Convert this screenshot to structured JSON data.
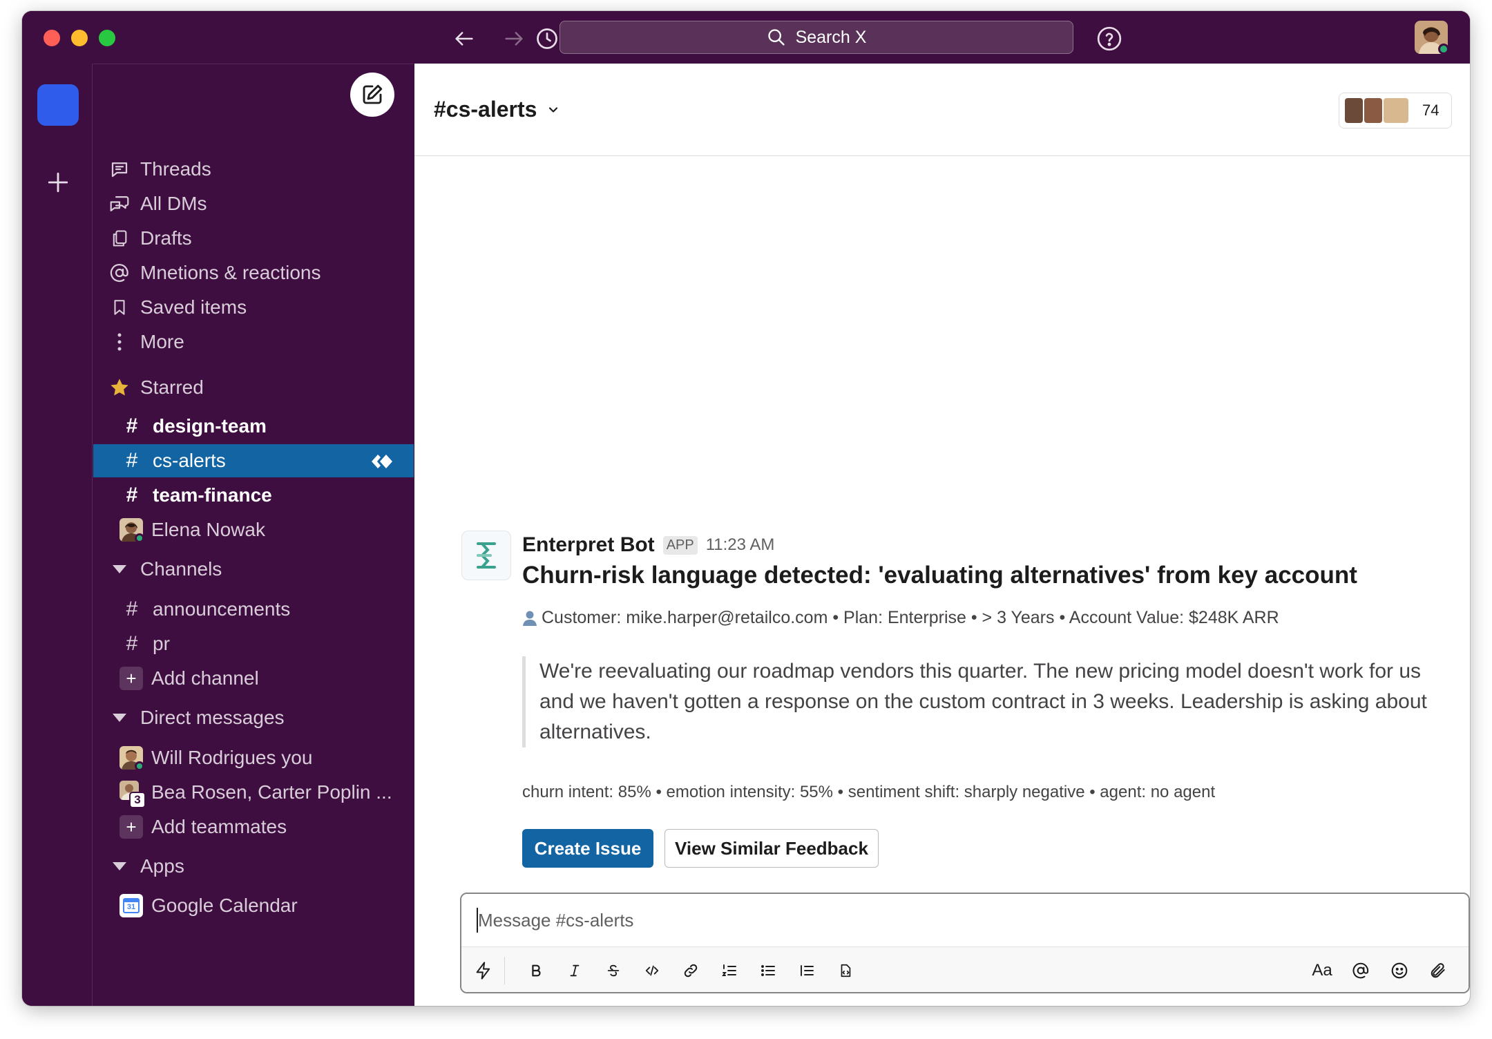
{
  "titlebar": {
    "search_text": "Search X"
  },
  "sidebar": {
    "nav": [
      {
        "label": "Threads",
        "icon": "threads-icon"
      },
      {
        "label": "All DMs",
        "icon": "dms-icon"
      },
      {
        "label": "Drafts",
        "icon": "drafts-icon"
      },
      {
        "label": "Mnetions & reactions",
        "icon": "at-icon"
      },
      {
        "label": "Saved items",
        "icon": "bookmark-icon"
      },
      {
        "label": "More",
        "icon": "more-vertical-icon"
      }
    ],
    "starred": {
      "label": "Starred",
      "items": [
        {
          "hash": "#",
          "label": "design-team"
        },
        {
          "hash": "#",
          "label": "cs-alerts"
        },
        {
          "hash": "#",
          "label": "team-finance"
        },
        {
          "label": "Elena Nowak"
        }
      ]
    },
    "channels": {
      "label": "Channels",
      "items": [
        {
          "hash": "#",
          "label": "announcements"
        },
        {
          "hash": "#",
          "label": "pr"
        }
      ],
      "add_label": "Add channel"
    },
    "dms": {
      "label": "Direct messages",
      "items": [
        {
          "label": "Will Rodrigues you"
        },
        {
          "label": "Bea Rosen, Carter Poplin ...",
          "badge": "3"
        }
      ],
      "add_label": "Add teammates"
    },
    "apps": {
      "label": "Apps",
      "items": [
        {
          "label": "Google Calendar",
          "icon_text": "31"
        }
      ]
    },
    "add_symbol": "+"
  },
  "channel": {
    "name": "#cs-alerts",
    "member_count": "74"
  },
  "message": {
    "bot_name": "Enterpret Bot",
    "app_badge": "APP",
    "time": "11:23 AM",
    "title": "Churn-risk language detected: 'evaluating alternatives' from key account",
    "meta": "Customer: mike.harper@retailco.com • Plan: Enterprise • > 3 Years • Account Value: $248K ARR",
    "quote": "We're reevaluating our roadmap vendors this quarter. The new pricing model doesn't work for us and we haven't gotten a response on the custom contract in 3 weeks. Leadership is asking about alternatives.",
    "scores": "churn intent: 85% • emotion intensity: 55% • sentiment shift: sharply negative • agent: no agent",
    "primary_button": "Create Issue",
    "secondary_button": "View Similar Feedback"
  },
  "composer": {
    "placeholder": "Message #cs-alerts",
    "format_label": "Aa"
  },
  "colors": {
    "aubergine": "#3f0e40",
    "active_channel": "#1264a3",
    "workspace_tile": "#2f5ceb",
    "presence": "#2bac76"
  }
}
